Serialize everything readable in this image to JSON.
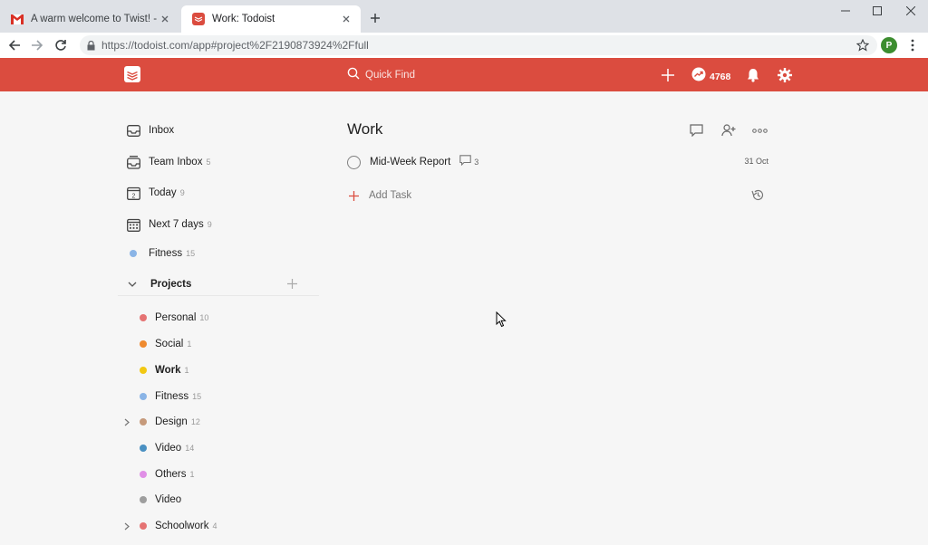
{
  "browser": {
    "tabs": [
      {
        "title": "A warm welcome to Twist! - hcsc",
        "icon": "gmail-icon"
      },
      {
        "title": "Work: Todoist",
        "icon": "todoist-icon"
      }
    ],
    "url": "https://todoist.com/app#project%2F2190873924%2Ffull",
    "profile_initial": "P"
  },
  "header": {
    "quick_find_label": "Quick Find",
    "karma_points": "4768",
    "brand_color": "#db4c3f"
  },
  "sidebar": {
    "nav": [
      {
        "label": "Inbox",
        "count": ""
      },
      {
        "label": "Team Inbox",
        "count": "5"
      },
      {
        "label": "Today",
        "count": "9",
        "icon_text": "2"
      },
      {
        "label": "Next 7 days",
        "count": "9"
      },
      {
        "label": "Fitness",
        "count": "15",
        "color": "#8ab4e6"
      }
    ],
    "projects_label": "Projects",
    "projects": [
      {
        "name": "Personal",
        "count": "10",
        "color": "#e57373"
      },
      {
        "name": "Social",
        "count": "1",
        "color": "#ef8a2f"
      },
      {
        "name": "Work",
        "count": "1",
        "color": "#f2c812"
      },
      {
        "name": "Fitness",
        "count": "15",
        "color": "#8ab4e6"
      },
      {
        "name": "Design",
        "count": "12",
        "color": "#c69a7b"
      },
      {
        "name": "Video",
        "count": "14",
        "color": "#4a90c2"
      },
      {
        "name": "Others",
        "count": "1",
        "color": "#e08fe6"
      },
      {
        "name": "Video",
        "count": "",
        "color": "#9e9e9e"
      },
      {
        "name": "Schoolwork",
        "count": "4",
        "color": "#e57373"
      }
    ]
  },
  "main": {
    "title": "Work",
    "tasks": [
      {
        "name": "Mid-Week Report",
        "comments": "3",
        "due": "31 Oct"
      }
    ],
    "add_task_label": "Add Task"
  }
}
